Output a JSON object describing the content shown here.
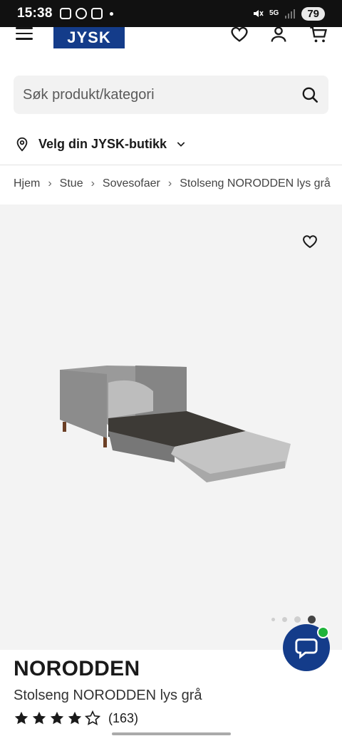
{
  "status_bar": {
    "time": "15:38",
    "network": "5G",
    "battery": "79"
  },
  "header": {
    "logo_text": "JYSK"
  },
  "search": {
    "placeholder": "Søk produkt/kategori"
  },
  "store": {
    "label": "Velg din JYSK-butikk"
  },
  "breadcrumb": {
    "items": [
      "Hjem",
      "Stue",
      "Sovesofaer",
      "Stolseng NORODDEN lys grå"
    ]
  },
  "gallery": {
    "image_count": 4,
    "active_index": 3
  },
  "product": {
    "name": "NORODDEN",
    "subtitle": "Stolseng NORODDEN lys grå",
    "rating": 4,
    "rating_max": 5,
    "review_count": "(163)"
  },
  "colors": {
    "brand_blue": "#143c8a",
    "online_green": "#1fb33a"
  }
}
